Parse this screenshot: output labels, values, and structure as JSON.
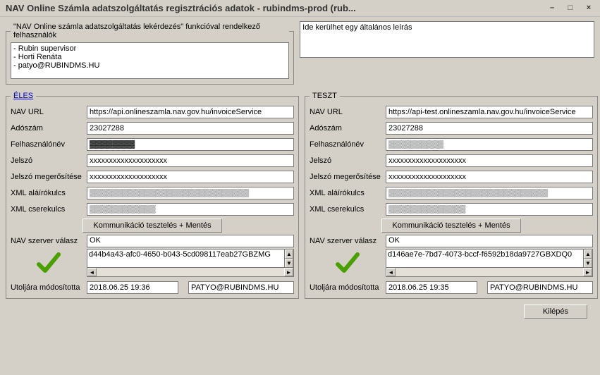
{
  "window": {
    "title": "NAV Online Számla adatszolgáltatás regisztrációs adatok - rubindms-prod (rub...",
    "min": "–",
    "max": "□",
    "close": "×"
  },
  "users_legend": "\"NAV Online számla adatszolgáltatás lekérdezés\" funkcióval rendelkező felhasználók",
  "users_text": "- Rubin supervisor\n- Horti Renáta\n- patyo@RUBINDMS.HU",
  "description": "Ide kerülhet egy általános leírás",
  "labels": {
    "nav_url": "NAV URL",
    "adoszam": "Adószám",
    "felhasznalonev": "Felhasználónév",
    "jelszo": "Jelszó",
    "jelszo2": "Jelszó megerősítése",
    "xml_alairo": "XML aláírókulcs",
    "xml_csere": "XML cserekulcs",
    "valasz": "NAV szerver válasz",
    "mod": "Utoljára módosította"
  },
  "buttons": {
    "test": "Kommunikáció tesztelés + Mentés",
    "exit": "Kilépés"
  },
  "eles": {
    "legend": "ÉLES",
    "url": "https://api.onlineszamla.nav.gov.hu/invoiceService",
    "adoszam": "23027288",
    "user_masked": "▓▓▓▓▓▓▓▓",
    "pass": "xxxxxxxxxxxxxxxxxxxx",
    "xml_alairo_masked": "▒▒▒▒▒▒▒▒▒▒▒▒▒▒▒▒▒▒▒▒▒▒▒▒▒▒▒▒▒",
    "xml_csere_masked": "▒▒▒▒▒▒▒▒▒▒▒▒",
    "response": "OK",
    "detail": "d44b4a43-afc0-4650-b043-5cd098117eab27GBZMG",
    "mod_ts": "2018.06.25 19:36",
    "mod_who": "PATYO@RUBINDMS.HU"
  },
  "teszt": {
    "legend": "TESZT",
    "url": "https://api-test.onlineszamla.nav.gov.hu/invoiceService",
    "adoszam": "23027288",
    "user_masked": "▒▒▒▒▒▒▒▒▒▒",
    "pass": "xxxxxxxxxxxxxxxxxxxx",
    "xml_alairo_masked": "▒▒▒▒▒▒▒▒▒▒▒▒▒▒▒▒▒▒▒▒▒▒▒▒▒▒▒▒▒",
    "xml_csere_masked": "▒▒▒▒▒▒▒▒▒▒▒▒▒▒",
    "response": "OK",
    "detail": "d146ae7e-7bd7-4073-bccf-f6592b18da9727GBXDQ0",
    "mod_ts": "2018.06.25 19:35",
    "mod_who": "PATYO@RUBINDMS.HU"
  }
}
